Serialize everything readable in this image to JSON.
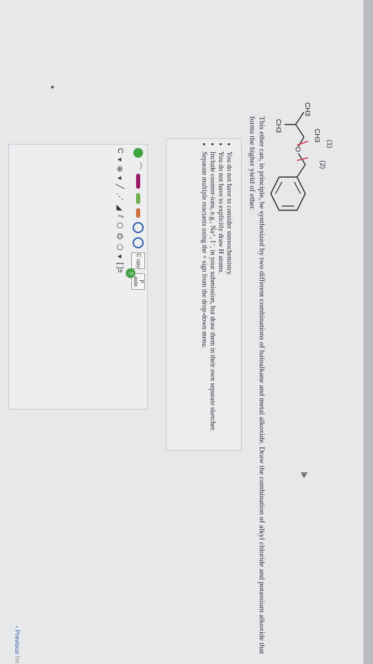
{
  "molecule": {
    "ch3_top": "CH3",
    "ch3_left": "CH3",
    "ch3_bottom": "CH3",
    "oxygen": "O",
    "bond1": "(1)",
    "bond2": "(2)"
  },
  "question": {
    "text": "This ether can, in principle, be synthesized by two different combinations of haloalkane and metal alkoxide. Draw the combination of alkyl chloride and potassium alkoxide that forms the higher yield of ether."
  },
  "hints": [
    "You do not have to consider stereochemistry.",
    "You do not have to explicitly draw H atoms.",
    "Include counter-ions, e.g., Na⁺, I⁻, in your submission, but draw them in their own separate sketcher.",
    "Separate multiple reactants using the + sign from the drop-down menu."
  ],
  "toolbar": {
    "copy_label": "C opy",
    "paste_label": "P aste",
    "element_label": "C",
    "charge_label": "⊕",
    "bracket_label": "[ ]±",
    "help_label": "?"
  },
  "nav": {
    "previous": "Previous",
    "next": "Ne"
  },
  "colors": {
    "accent_pen": "#9b1d6a",
    "green": "#3fa33f",
    "blue": "#2f5fa8",
    "bond_marker": "#d2334a"
  }
}
